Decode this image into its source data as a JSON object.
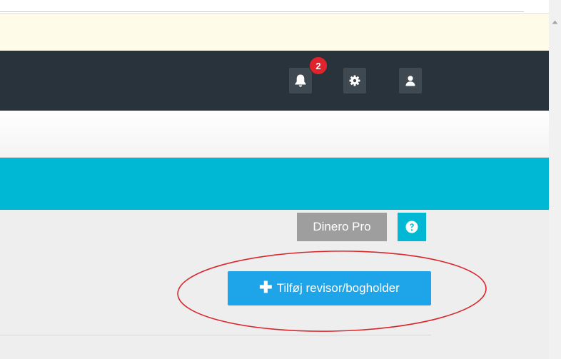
{
  "navbar": {
    "notifications": {
      "icon": "bell-icon",
      "count": "2"
    },
    "settings": {
      "icon": "gear-icon"
    },
    "profile": {
      "icon": "user-icon"
    }
  },
  "content": {
    "plan_label": "Dinero Pro",
    "help_icon": "question-circle-icon",
    "add_button_label": "Tilføj revisor/bogholder",
    "add_button_icon": "plus-icon"
  },
  "colors": {
    "navbar": "#29333b",
    "accent_teal": "#00b8d4",
    "button_blue": "#1ea4e9",
    "badge_red": "#e1242c",
    "annotation_red": "#d9262b"
  }
}
